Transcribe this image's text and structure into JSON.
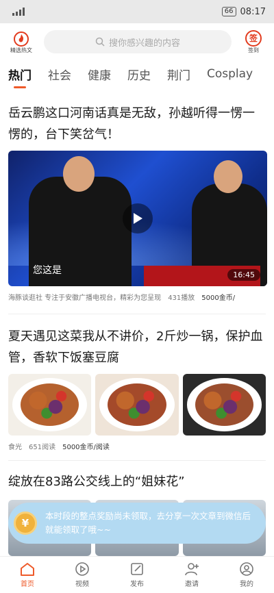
{
  "status": {
    "battery": "66",
    "time": "08:17"
  },
  "header": {
    "hot_label": "精选热文",
    "search_placeholder": "搜你感兴趣的内容",
    "sign_icon_text": "签",
    "sign_label": "签到"
  },
  "tabs": [
    {
      "label": "热门",
      "active": true
    },
    {
      "label": "社会"
    },
    {
      "label": "健康"
    },
    {
      "label": "历史"
    },
    {
      "label": "荆门"
    },
    {
      "label": "Cosplay"
    }
  ],
  "articles": [
    {
      "title": "岳云鹏这口河南话真是无敌，孙越听得一愣一愣的，台下笑岔气！",
      "video_caption": "您这是",
      "duration": "16:45",
      "source": "海豚谈逛社 专注于安徽广播电视台，精彩为您呈现",
      "views": "431播放",
      "reward": "5000金币/"
    },
    {
      "title": "夏天遇见这菜我从不讲价，2斤炒一锅，保护血管，香软下饭塞豆腐",
      "source": "食光",
      "views": "651阅读",
      "reward": "5000金币/阅读"
    },
    {
      "title": "绽放在83路公交线上的“姐妹花”"
    }
  ],
  "toast": {
    "coin_symbol": "¥",
    "text": "本时段的整点奖励尚未领取，去分享一次文章到微信后就能领取了哦~~"
  },
  "nav": [
    {
      "label": "首页",
      "active": true,
      "icon": "home-icon"
    },
    {
      "label": "视频",
      "icon": "video-icon"
    },
    {
      "label": "发布",
      "icon": "publish-icon"
    },
    {
      "label": "邀请",
      "icon": "invite-icon"
    },
    {
      "label": "我的",
      "icon": "profile-icon"
    }
  ],
  "colors": {
    "accent": "#ee5a2a",
    "toast_bg": "#b3daf2",
    "coin": "#f0b23c"
  }
}
